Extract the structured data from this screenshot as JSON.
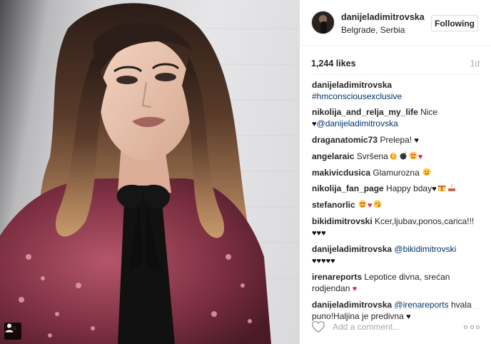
{
  "post": {
    "owner": "danijeladimitrovska",
    "location": "Belgrade, Serbia",
    "follow_label": "Following",
    "likes": "1,244 likes",
    "time": "1d",
    "user_tag_icon": "person-icon"
  },
  "comments": [
    {
      "user": "danijeladimitrovska",
      "parts": [
        {
          "t": "tag",
          "v": "#hmconsciousexclusive"
        }
      ]
    },
    {
      "user": "nikolija_and_relja_my_life",
      "parts": [
        {
          "t": "text",
          "v": "Nice "
        },
        {
          "t": "black-heart",
          "v": "♥"
        },
        {
          "t": "tag",
          "v": "@danijeladimitrovska"
        }
      ]
    },
    {
      "user": "draganatomic73",
      "parts": [
        {
          "t": "text",
          "v": "Prelepa! "
        },
        {
          "t": "black-heart",
          "v": "♥"
        }
      ]
    },
    {
      "user": "angelaraic",
      "parts": [
        {
          "t": "text",
          "v": "Svršena"
        },
        {
          "t": "emoji",
          "v": "fire"
        },
        {
          "t": "emoji",
          "v": "bomb"
        },
        {
          "t": "emoji",
          "v": "heart-eyes"
        },
        {
          "t": "red-heart",
          "v": "♥"
        }
      ]
    },
    {
      "user": "makivicdusica",
      "parts": [
        {
          "t": "text",
          "v": "Glamurozna "
        },
        {
          "t": "emoji",
          "v": "smile"
        }
      ]
    },
    {
      "user": "nikolija_fan_page",
      "parts": [
        {
          "t": "text",
          "v": "Happy bday"
        },
        {
          "t": "black-heart",
          "v": "♥"
        },
        {
          "t": "emoji",
          "v": "gift"
        },
        {
          "t": "emoji",
          "v": "cake"
        }
      ]
    },
    {
      "user": "stefanorlic",
      "parts": [
        {
          "t": "emoji",
          "v": "heart-eyes"
        },
        {
          "t": "red-heart",
          "v": "♥"
        },
        {
          "t": "emoji",
          "v": "kiss"
        }
      ]
    },
    {
      "user": "bikidimitrovski",
      "parts": [
        {
          "t": "text",
          "v": "Kcer,ljubav,ponos,carica!!! "
        },
        {
          "t": "black-heart",
          "v": "♥♥♥"
        }
      ]
    },
    {
      "user": "danijeladimitrovska",
      "parts": [
        {
          "t": "tag",
          "v": "@bikidimitrovski"
        },
        {
          "t": "text",
          "v": " "
        },
        {
          "t": "black-heart",
          "v": "♥♥♥♥♥"
        }
      ]
    },
    {
      "user": "irenareports",
      "parts": [
        {
          "t": "text",
          "v": "Lepotice divna, srećan rodjendan "
        },
        {
          "t": "red-heart",
          "v": "♥"
        }
      ]
    },
    {
      "user": "danijeladimitrovska",
      "parts": [
        {
          "t": "tag",
          "v": "@irenareports"
        },
        {
          "t": "text",
          "v": " hvala puno!Haljina je predivna "
        },
        {
          "t": "black-heart",
          "v": "♥"
        }
      ]
    }
  ],
  "add_comment": {
    "placeholder": "Add a comment...",
    "like_icon": "heart-outline-icon",
    "more_icon": "more-options-icon"
  },
  "colors": {
    "link": "#003569",
    "text": "#262626",
    "muted": "#a8a8a8",
    "border": "#efefef"
  }
}
